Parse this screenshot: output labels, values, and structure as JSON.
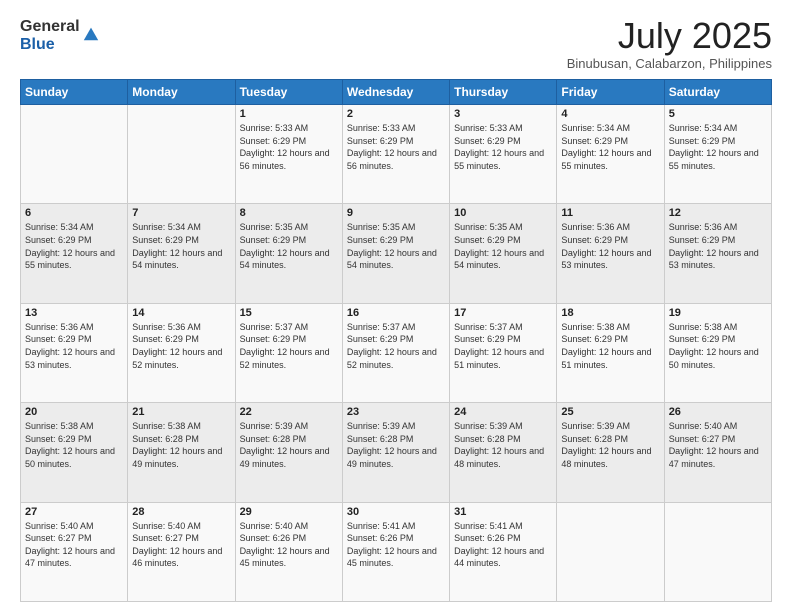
{
  "logo": {
    "general": "General",
    "blue": "Blue"
  },
  "header": {
    "month": "July 2025",
    "location": "Binubusan, Calabarzon, Philippines"
  },
  "weekdays": [
    "Sunday",
    "Monday",
    "Tuesday",
    "Wednesday",
    "Thursday",
    "Friday",
    "Saturday"
  ],
  "weeks": [
    [
      {
        "day": "",
        "info": ""
      },
      {
        "day": "",
        "info": ""
      },
      {
        "day": "1",
        "info": "Sunrise: 5:33 AM\nSunset: 6:29 PM\nDaylight: 12 hours and 56 minutes."
      },
      {
        "day": "2",
        "info": "Sunrise: 5:33 AM\nSunset: 6:29 PM\nDaylight: 12 hours and 56 minutes."
      },
      {
        "day": "3",
        "info": "Sunrise: 5:33 AM\nSunset: 6:29 PM\nDaylight: 12 hours and 55 minutes."
      },
      {
        "day": "4",
        "info": "Sunrise: 5:34 AM\nSunset: 6:29 PM\nDaylight: 12 hours and 55 minutes."
      },
      {
        "day": "5",
        "info": "Sunrise: 5:34 AM\nSunset: 6:29 PM\nDaylight: 12 hours and 55 minutes."
      }
    ],
    [
      {
        "day": "6",
        "info": "Sunrise: 5:34 AM\nSunset: 6:29 PM\nDaylight: 12 hours and 55 minutes."
      },
      {
        "day": "7",
        "info": "Sunrise: 5:34 AM\nSunset: 6:29 PM\nDaylight: 12 hours and 54 minutes."
      },
      {
        "day": "8",
        "info": "Sunrise: 5:35 AM\nSunset: 6:29 PM\nDaylight: 12 hours and 54 minutes."
      },
      {
        "day": "9",
        "info": "Sunrise: 5:35 AM\nSunset: 6:29 PM\nDaylight: 12 hours and 54 minutes."
      },
      {
        "day": "10",
        "info": "Sunrise: 5:35 AM\nSunset: 6:29 PM\nDaylight: 12 hours and 54 minutes."
      },
      {
        "day": "11",
        "info": "Sunrise: 5:36 AM\nSunset: 6:29 PM\nDaylight: 12 hours and 53 minutes."
      },
      {
        "day": "12",
        "info": "Sunrise: 5:36 AM\nSunset: 6:29 PM\nDaylight: 12 hours and 53 minutes."
      }
    ],
    [
      {
        "day": "13",
        "info": "Sunrise: 5:36 AM\nSunset: 6:29 PM\nDaylight: 12 hours and 53 minutes."
      },
      {
        "day": "14",
        "info": "Sunrise: 5:36 AM\nSunset: 6:29 PM\nDaylight: 12 hours and 52 minutes."
      },
      {
        "day": "15",
        "info": "Sunrise: 5:37 AM\nSunset: 6:29 PM\nDaylight: 12 hours and 52 minutes."
      },
      {
        "day": "16",
        "info": "Sunrise: 5:37 AM\nSunset: 6:29 PM\nDaylight: 12 hours and 52 minutes."
      },
      {
        "day": "17",
        "info": "Sunrise: 5:37 AM\nSunset: 6:29 PM\nDaylight: 12 hours and 51 minutes."
      },
      {
        "day": "18",
        "info": "Sunrise: 5:38 AM\nSunset: 6:29 PM\nDaylight: 12 hours and 51 minutes."
      },
      {
        "day": "19",
        "info": "Sunrise: 5:38 AM\nSunset: 6:29 PM\nDaylight: 12 hours and 50 minutes."
      }
    ],
    [
      {
        "day": "20",
        "info": "Sunrise: 5:38 AM\nSunset: 6:29 PM\nDaylight: 12 hours and 50 minutes."
      },
      {
        "day": "21",
        "info": "Sunrise: 5:38 AM\nSunset: 6:28 PM\nDaylight: 12 hours and 49 minutes."
      },
      {
        "day": "22",
        "info": "Sunrise: 5:39 AM\nSunset: 6:28 PM\nDaylight: 12 hours and 49 minutes."
      },
      {
        "day": "23",
        "info": "Sunrise: 5:39 AM\nSunset: 6:28 PM\nDaylight: 12 hours and 49 minutes."
      },
      {
        "day": "24",
        "info": "Sunrise: 5:39 AM\nSunset: 6:28 PM\nDaylight: 12 hours and 48 minutes."
      },
      {
        "day": "25",
        "info": "Sunrise: 5:39 AM\nSunset: 6:28 PM\nDaylight: 12 hours and 48 minutes."
      },
      {
        "day": "26",
        "info": "Sunrise: 5:40 AM\nSunset: 6:27 PM\nDaylight: 12 hours and 47 minutes."
      }
    ],
    [
      {
        "day": "27",
        "info": "Sunrise: 5:40 AM\nSunset: 6:27 PM\nDaylight: 12 hours and 47 minutes."
      },
      {
        "day": "28",
        "info": "Sunrise: 5:40 AM\nSunset: 6:27 PM\nDaylight: 12 hours and 46 minutes."
      },
      {
        "day": "29",
        "info": "Sunrise: 5:40 AM\nSunset: 6:26 PM\nDaylight: 12 hours and 45 minutes."
      },
      {
        "day": "30",
        "info": "Sunrise: 5:41 AM\nSunset: 6:26 PM\nDaylight: 12 hours and 45 minutes."
      },
      {
        "day": "31",
        "info": "Sunrise: 5:41 AM\nSunset: 6:26 PM\nDaylight: 12 hours and 44 minutes."
      },
      {
        "day": "",
        "info": ""
      },
      {
        "day": "",
        "info": ""
      }
    ]
  ]
}
